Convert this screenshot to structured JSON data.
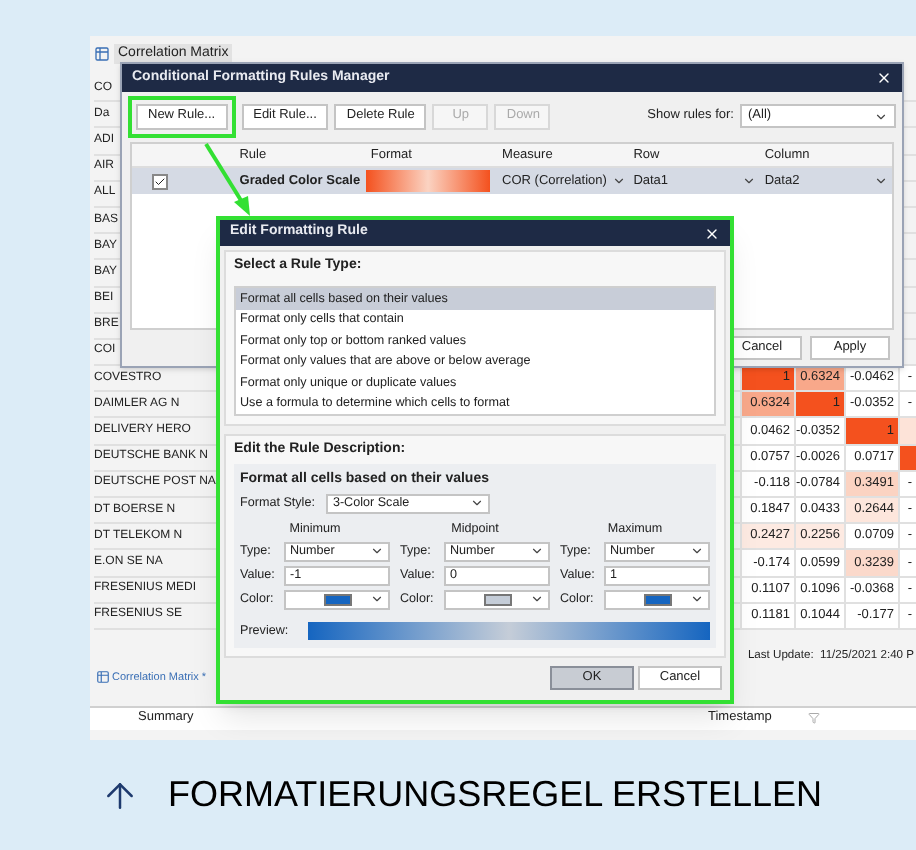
{
  "document_tab": {
    "title": "Correlation Matrix"
  },
  "grid": {
    "rows": [
      {
        "name": "CO"
      },
      {
        "name": "Da"
      },
      {
        "name": "ADI"
      },
      {
        "name": "AIR"
      },
      {
        "name": "ALL"
      },
      {
        "name": "BAS"
      },
      {
        "name": "BAY"
      },
      {
        "name": "BAY"
      },
      {
        "name": "BEI"
      },
      {
        "name": "BRE"
      },
      {
        "name": "COI"
      },
      {
        "name": "COVESTRO",
        "cells": [
          {
            "text": "1",
            "color": "#f4511e"
          },
          {
            "text": "0.6324",
            "color": "#f8a88a"
          },
          {
            "text": "-0.0462"
          },
          {
            "text": "-"
          }
        ]
      },
      {
        "name": "DAIMLER AG N",
        "cells": [
          {
            "text": "0.6324",
            "color": "#f8a88a"
          },
          {
            "text": "1",
            "color": "#f4511e"
          },
          {
            "text": "-0.0352"
          },
          {
            "text": "-"
          }
        ]
      },
      {
        "name": "DELIVERY HERO",
        "cells": [
          {
            "text": "0.0462"
          },
          {
            "text": "-0.0352"
          },
          {
            "text": "1",
            "color": "#f4511e"
          },
          {
            "color": "#fde3d8"
          }
        ]
      },
      {
        "name": "DEUTSCHE BANK N",
        "cells": [
          {
            "text": "0.0757"
          },
          {
            "text": "-0.0026"
          },
          {
            "text": "0.0717"
          },
          {
            "color": "#f4511e"
          }
        ]
      },
      {
        "name": "DEUTSCHE POST NA",
        "cells": [
          {
            "text": "-0.118"
          },
          {
            "text": "-0.0784"
          },
          {
            "text": "0.3491",
            "color": "#fbd3c2"
          },
          {
            "text": "-"
          }
        ]
      },
      {
        "name": "DT BOERSE N",
        "cells": [
          {
            "text": "0.1847"
          },
          {
            "text": "0.0433"
          },
          {
            "text": "0.2644",
            "color": "#fde6dc"
          },
          {
            "text": "-"
          }
        ]
      },
      {
        "name": "DT TELEKOM N",
        "cells": [
          {
            "text": "0.2427",
            "color": "#fdeae2"
          },
          {
            "text": "0.2256",
            "color": "#fdeae2"
          },
          {
            "text": "0.0709"
          },
          {
            "text": "-"
          }
        ]
      },
      {
        "name": "E.ON SE NA",
        "cells": [
          {
            "text": "-0.174"
          },
          {
            "text": "0.0599"
          },
          {
            "text": "0.3239",
            "color": "#fbd9cb"
          },
          {
            "text": "-"
          }
        ]
      },
      {
        "name": "FRESENIUS MEDI",
        "cells": [
          {
            "text": "0.1107"
          },
          {
            "text": "0.1096"
          },
          {
            "text": "-0.0368"
          },
          {
            "text": "-"
          }
        ]
      },
      {
        "name": "FRESENIUS SE",
        "cells": [
          {
            "text": "0.1181"
          },
          {
            "text": "0.1044"
          },
          {
            "text": "-0.177"
          },
          {
            "text": "-"
          }
        ]
      }
    ]
  },
  "rules_manager": {
    "title": "Conditional Formatting Rules Manager",
    "toolbar": [
      {
        "label": "New Rule...",
        "disabled": false,
        "highlighted": true
      },
      {
        "label": "Edit Rule...",
        "disabled": false,
        "highlighted": false
      },
      {
        "label": "Delete Rule",
        "disabled": false,
        "highlighted": false
      },
      {
        "label": "Up",
        "disabled": true,
        "highlighted": false
      },
      {
        "label": "Down",
        "disabled": true,
        "highlighted": false
      }
    ],
    "show_rules_label": "Show rules for:",
    "show_rules_value": "(All)",
    "columns": [
      "Rule",
      "Format",
      "Measure",
      "Row",
      "Column"
    ],
    "rules": [
      {
        "checked": true,
        "selected": true,
        "rule": "Graded Color Scale",
        "measure": "COR (Correlation)",
        "row": "Data1",
        "column": "Data2"
      }
    ],
    "buttons": [
      "Cancel",
      "Apply"
    ]
  },
  "edit_rule_dialog": {
    "title": "Edit Formatting Rule",
    "highlighted": true,
    "select_heading": "Select a Rule Type:",
    "rule_types": [
      {
        "label": "Format all cells based on their values",
        "selected": true
      },
      {
        "label": "Format only cells that contain",
        "selected": false
      },
      {
        "label": "Format only top or bottom ranked values",
        "selected": false
      },
      {
        "label": "Format only values that are above or below average",
        "selected": false
      },
      {
        "label": "Format only unique or duplicate values",
        "selected": false
      },
      {
        "label": "Use a formula to determine which cells to format",
        "selected": false
      }
    ],
    "description_heading": "Edit the Rule Description:",
    "description_title": "Format all cells based on their values",
    "format_style_label": "Format Style:",
    "format_style": "3-Color Scale",
    "points": [
      {
        "heading": "Minimum",
        "type_label": "Type:",
        "type": "Number",
        "value_label": "Value:",
        "value": "-1",
        "color_label": "Color:",
        "color": "#1565c0"
      },
      {
        "heading": "Midpoint",
        "type_label": "Type:",
        "type": "Number",
        "value_label": "Value:",
        "value": "0",
        "color_label": "Color:",
        "color": "#c5cdd8"
      },
      {
        "heading": "Maximum",
        "type_label": "Type:",
        "type": "Number",
        "value_label": "Value:",
        "value": "1",
        "color_label": "Color:",
        "color": "#1565c0"
      }
    ],
    "preview_label": "Preview:",
    "buttons": [
      {
        "label": "OK",
        "selected": true
      },
      {
        "label": "Cancel",
        "selected": false
      }
    ]
  },
  "status": {
    "last_update": "Last Update:  11/25/2021 2:40 P"
  },
  "bottom_tab": {
    "label": "Correlation Matrix *"
  },
  "summary_table": {
    "columns": [
      "Summary",
      "Timestamp"
    ]
  },
  "caption": {
    "text": "FORMATIERUNGSREGEL ERSTELLEN"
  }
}
